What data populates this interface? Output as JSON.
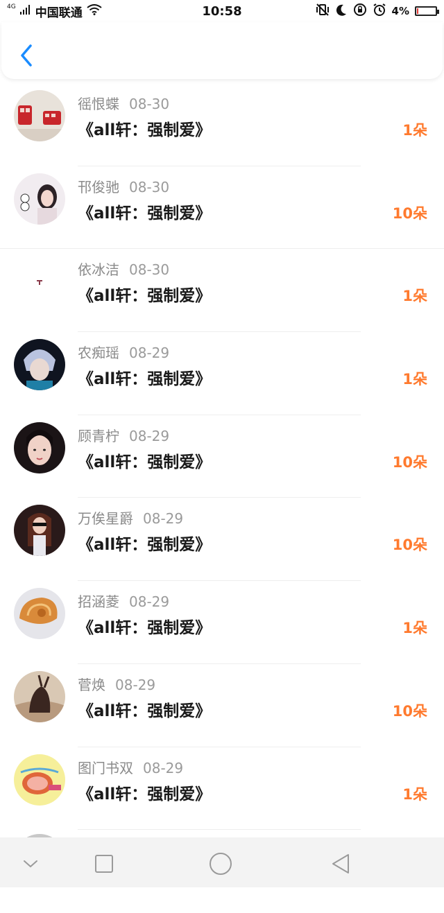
{
  "status": {
    "network": "4G",
    "carrier": "中国联通",
    "time": "10:58",
    "battery": "4%"
  },
  "header": {
    "back_icon": "chevron-left-icon"
  },
  "items": [
    {
      "name": "徭恨蝶",
      "date": "08-30",
      "title": "《all轩：强制爱》",
      "count": "1朵"
    },
    {
      "name": "邗俊驰",
      "date": "08-30",
      "title": "《all轩：强制爱》",
      "count": "10朵"
    },
    {
      "name": "依冰洁",
      "date": "08-30",
      "title": "《all轩：强制爱》",
      "count": "1朵"
    },
    {
      "name": "农痴瑶",
      "date": "08-29",
      "title": "《all轩：强制爱》",
      "count": "1朵"
    },
    {
      "name": "顾青柠",
      "date": "08-29",
      "title": "《all轩：强制爱》",
      "count": "10朵"
    },
    {
      "name": "万俟星爵",
      "date": "08-29",
      "title": "《all轩：强制爱》",
      "count": "10朵"
    },
    {
      "name": "招涵菱",
      "date": "08-29",
      "title": "《all轩：强制爱》",
      "count": "1朵"
    },
    {
      "name": "菅焕",
      "date": "08-29",
      "title": "《all轩：强制爱》",
      "count": "10朵"
    },
    {
      "name": "图门书双",
      "date": "08-29",
      "title": "《all轩：强制爱》",
      "count": "1朵"
    }
  ],
  "colors": {
    "accent": "#1a8cff",
    "count": "#ff7a2e"
  },
  "navbar": [
    "chevron-down-icon",
    "square-icon",
    "circle-icon",
    "triangle-back-icon"
  ]
}
